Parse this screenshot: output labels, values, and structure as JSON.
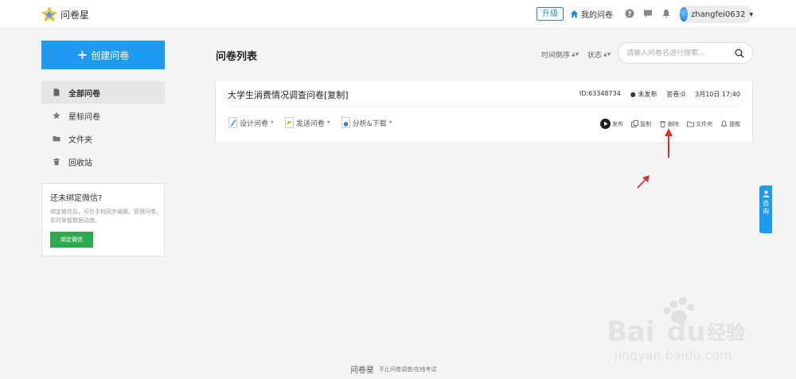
{
  "header": {
    "app_name": "问卷星",
    "upgrade_label": "升级",
    "my_surveys_label": "我的问卷",
    "username": "zhangfei0632"
  },
  "sidebar": {
    "create_label": "创建问卷",
    "items": [
      {
        "label": "全部问卷",
        "icon": "document-icon",
        "active": true
      },
      {
        "label": "星标问卷",
        "icon": "star-icon",
        "active": false
      },
      {
        "label": "文件夹",
        "icon": "folder-icon",
        "active": false
      },
      {
        "label": "回收站",
        "icon": "trash-icon",
        "active": false
      }
    ],
    "wechat": {
      "title": "还未绑定微信?",
      "desc": "绑定微信后，可在手机同步编辑、管理问卷，实时掌握数据动态。",
      "button": "绑定微信"
    }
  },
  "main": {
    "title": "问卷列表",
    "sort_time": "时间倒序",
    "sort_status": "状态",
    "search_placeholder": "请输入问卷名进行搜索...",
    "survey": {
      "title": "大学生消费情况调查问卷[复制]",
      "id": "ID:63348734",
      "status": "未发布",
      "answers": "答卷:0",
      "date": "3月10日 17:40",
      "actions_left": [
        "设计问卷",
        "发送问卷",
        "分析&下载"
      ],
      "actions_right": [
        "发布",
        "复制",
        "删除",
        "文件夹",
        "提醒"
      ]
    }
  },
  "consult_label": "咨询",
  "footer": {
    "logo": "问卷星",
    "slogan": "不止问卷调查/在线考试"
  },
  "watermark": "Baidu经验 jingyan.baidu.com",
  "colors": {
    "primary": "#1e9bf0",
    "wechat_green": "#2eaa4e",
    "annotation_red": "#e03030"
  }
}
